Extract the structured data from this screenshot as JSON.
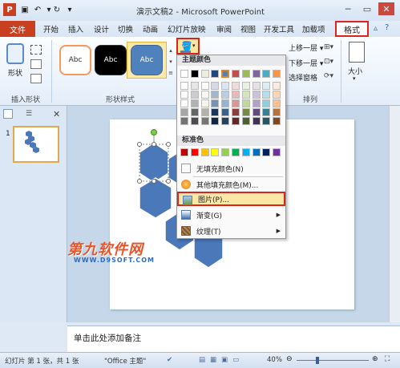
{
  "window": {
    "title": "演示文稿2 - Microsoft PowerPoint"
  },
  "tabs": {
    "file": "文件",
    "items": [
      "开始",
      "插入",
      "设计",
      "切换",
      "动画",
      "幻灯片放映",
      "审阅",
      "视图",
      "开发工具",
      "加载项"
    ],
    "format": "格式"
  },
  "ribbon": {
    "shape_label": "形状",
    "insert_shapes_group": "插入形状",
    "style_samples": [
      "Abc",
      "Abc",
      "Abc"
    ],
    "shape_styles_group": "形状样式",
    "align_label": "A",
    "bring_forward": "上移一层",
    "send_backward": "下移一层",
    "selection_pane": "选择窗格",
    "arrange_group": "排列",
    "size_label": "大小"
  },
  "fill_menu": {
    "theme_colors_header": "主题颜色",
    "standard_colors_header": "标准色",
    "no_fill": "无填充颜色(N)",
    "more_fill_colors": "其他填充颜色(M)...",
    "picture": "图片(P)...",
    "gradient": "渐变(G)",
    "texture": "纹理(T)",
    "theme_colors": [
      "#ffffff",
      "#000000",
      "#eeece1",
      "#1f497d",
      "#4f81bd",
      "#c0504d",
      "#9bbb59",
      "#8064a2",
      "#4bacc6",
      "#f79646"
    ],
    "standard_colors": [
      "#c00000",
      "#ff0000",
      "#ffc000",
      "#ffff00",
      "#92d050",
      "#00b050",
      "#00b0f0",
      "#0070c0",
      "#002060",
      "#7030a0"
    ]
  },
  "slide_panel": {
    "slide_number": "1"
  },
  "notes": {
    "placeholder": "单击此处添加备注"
  },
  "watermark": {
    "title": "第九软件网",
    "url": "WWW.D9SOFT.COM"
  },
  "status": {
    "slide_info": "幻灯片 第 1 张，共 1 张",
    "theme": "\"Office 主题\"",
    "zoom": "40%"
  },
  "colors": {
    "accent_red": "#d9261c",
    "shape_blue": "#4a78b8",
    "file_tab": "#c8401f"
  }
}
